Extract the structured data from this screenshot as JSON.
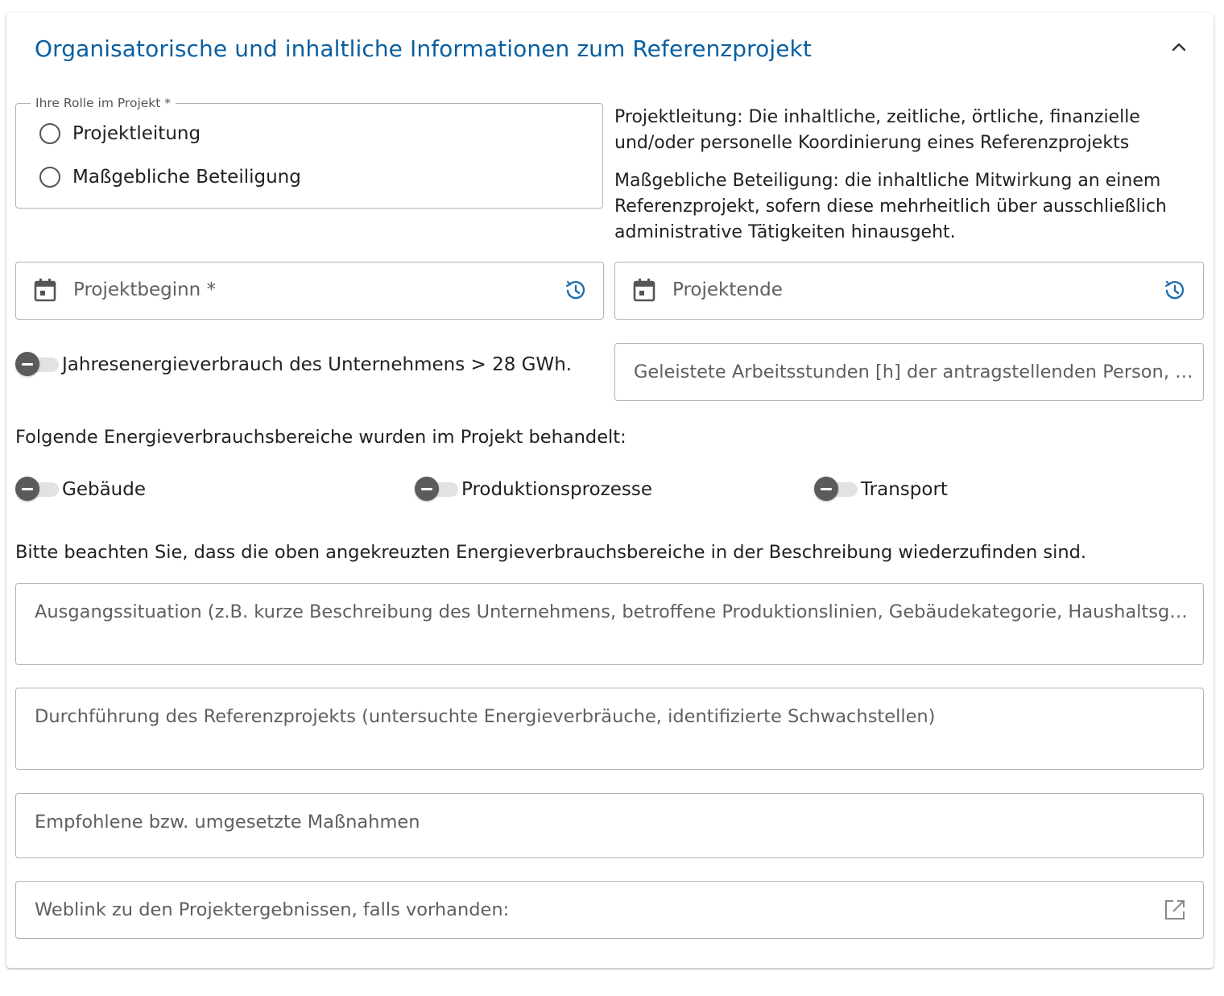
{
  "section": {
    "title": "Organisatorische und inhaltliche Informationen zum Referenzprojekt",
    "collapse_icon": "chevron-up-icon"
  },
  "role": {
    "legend": "Ihre Rolle im Projekt *",
    "options": [
      "Projektleitung",
      "Maßgebliche Beteiligung"
    ]
  },
  "info": {
    "projektleitung": "Projektleitung: Die inhaltliche, zeitliche, örtliche, finanzielle und/oder personelle Koordinierung eines Referenzprojekts",
    "beteiligung": "Maßgebliche Beteiligung: die inhaltliche Mitwirkung an einem Referenzprojekt, sofern diese mehrheitlich über ausschließlich administrative Tätigkeiten hinausgeht."
  },
  "dates": {
    "start_placeholder": "Projektbeginn *",
    "end_placeholder": "Projektende"
  },
  "energy_toggle_label": "Jahresenergieverbrauch des Unternehmens > 28 GWh.",
  "hours_placeholder": "Geleistete Arbeitsstunden [h] der antragstellenden Person, we...",
  "areas": {
    "intro": "Folgende Energieverbrauchsbereiche wurden im Projekt behandelt:",
    "items": [
      "Gebäude",
      "Produktionsprozesse",
      "Transport"
    ],
    "note": "Bitte beachten Sie, dass die oben angekreuzten Energieverbrauchsbereiche in der Beschreibung wiederzufinden sind."
  },
  "fields": {
    "ausgangssituation": "Ausgangssituation (z.B. kurze Beschreibung des Unternehmens, betroffene Produktionslinien, Gebäudekategorie, Haushaltsgröße, ...",
    "durchfuehrung": "Durchführung des Referenzprojekts (untersuchte Energieverbräuche, identifizierte Schwachstellen)",
    "massnahmen": "Empfohlene bzw. umgesetzte Maßnahmen",
    "weblink": "Weblink zu den Projektergebnissen, falls vorhanden:"
  },
  "colors": {
    "title": "#0a5fa0",
    "icon_accent": "#1f6fb0",
    "border": "#b3b3b3"
  }
}
